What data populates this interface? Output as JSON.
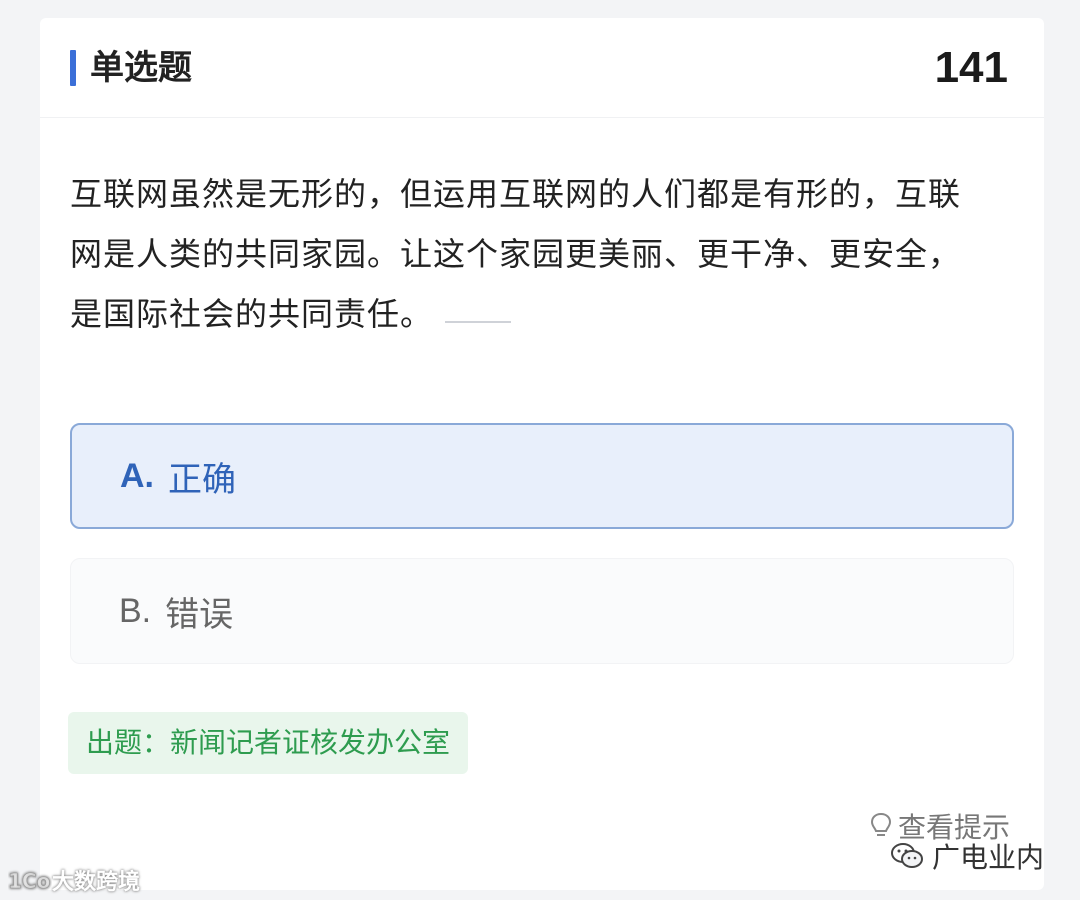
{
  "header": {
    "title": "单选题",
    "question_number": "141"
  },
  "question": {
    "line1": "互联网虽然是无形的，但运用互联网的人们都是有形的，互联",
    "line2": "网是人类的共同家园。让这个家园更美丽、更干净、更安全，",
    "line3": "是国际社会的共同责任。"
  },
  "options": [
    {
      "letter": "A.",
      "text": "正确",
      "selected": true
    },
    {
      "letter": "B.",
      "text": "错误",
      "selected": false
    }
  ],
  "source": "出题：新闻记者证核发办公室",
  "hint": "查看提示",
  "watermarks": {
    "left": "大数跨境",
    "right": "广电业内"
  },
  "colors": {
    "accent": "#3b6fd8",
    "selected_bg": "#e8effb",
    "selected_border": "#8aa9d8",
    "source_green": "#2e9c4f"
  }
}
